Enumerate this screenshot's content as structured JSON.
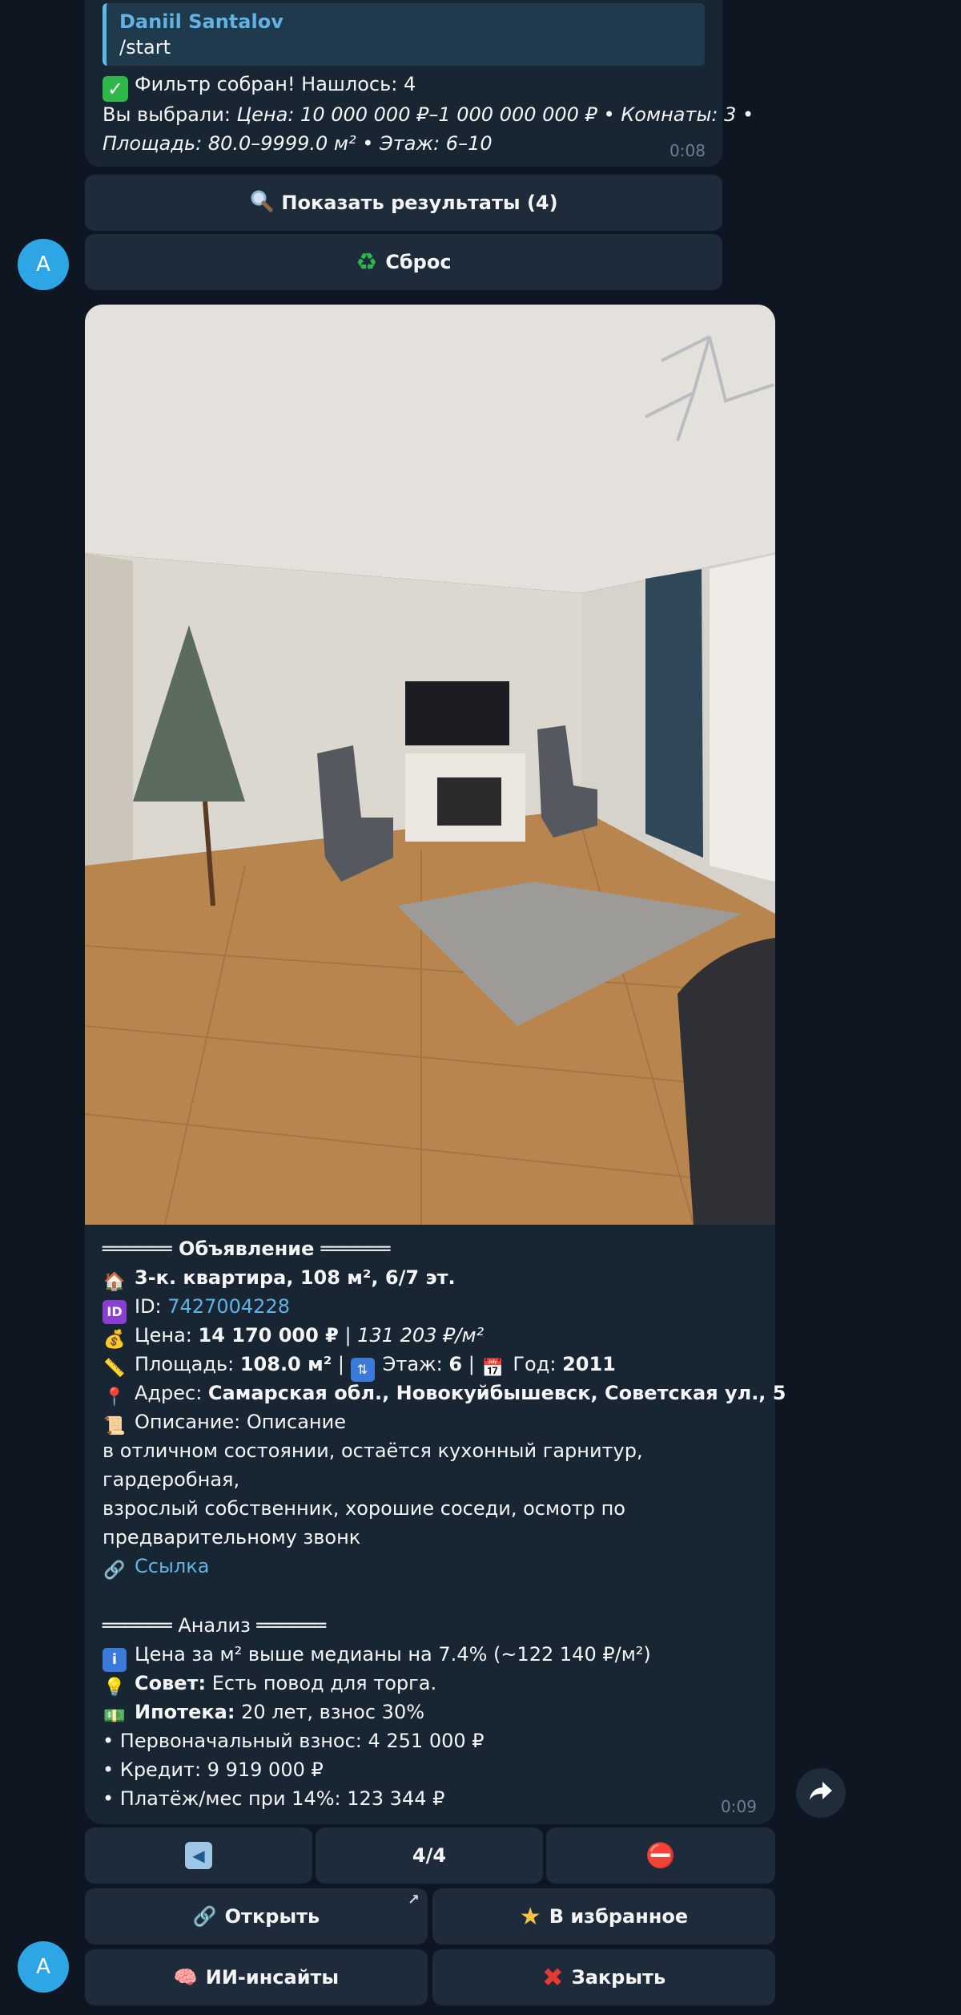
{
  "message1": {
    "quote_author": "Daniil Santalov",
    "quote_text": "/start",
    "filter_done": "Фильтр собран! Нашлось: 4",
    "selected_prefix": "Вы выбрали: ",
    "selected_line1": "Цена: 10 000 000 ₽–1 000 000 000 ₽ • Комнаты: 3 •",
    "selected_line2": "Площадь: 80.0–9999.0 м² • Этаж: 6–10",
    "time": "0:08"
  },
  "inline_keyboard_1": {
    "show_results": "Показать результаты (4)",
    "reset": "Сброс"
  },
  "avatar_letter": "A",
  "listing": {
    "header": "══════ Объявление ══════",
    "title": "3-к. квартира, 108 м², 6/7 эт.",
    "id_label": "ID: ",
    "id_value": "7427004228",
    "price_label": "Цена: ",
    "price_value": "14 170 000 ₽",
    "price_sep": " | ",
    "price_per_m2": "131 203 ₽/м²",
    "area_label": "Площадь: ",
    "area_value": "108.0 м²",
    "floor_label": "Этаж: ",
    "floor_value": "6",
    "year_label": "Год: ",
    "year_value": "2011",
    "address_label": "Адрес: ",
    "address_value": "Самарская обл., Новокуйбышевск, Советская ул., 5",
    "description_label": "Описание: Описание",
    "description_lines": [
      "в отличном состоянии, остаётся кухонный гарнитур,",
      "гардеробная,",
      "взрослый собственник, хорошие соседи, осмотр по",
      "предварительному звонк"
    ],
    "link_text": "Ссылка",
    "analysis_header": "══════ Анализ ══════",
    "analysis_price": "Цена за м² выше медианы на 7.4% (~122 140 ₽/м²)",
    "advice_label": "Совет:",
    "advice_text": " Есть повод для торга.",
    "mortgage_label": "Ипотека:",
    "mortgage_text": " 20 лет, взнос 30%",
    "down_payment": "• Первоначальный взнос: 4 251 000 ₽",
    "credit": "• Кредит: 9 919 000 ₽",
    "monthly": "• Платёж/мес при 14%: 123 344 ₽",
    "time": "0:09"
  },
  "inline_keyboard_2": {
    "prev": "◀",
    "page": "4/4",
    "stop": "⛔",
    "open": "Открыть",
    "favorite": "В избранное",
    "ai_insights": "ИИ-инсайты",
    "close": "Закрыть"
  },
  "colors": {
    "background": "#0e1621",
    "bubble": "#182533",
    "button": "#1d2b3a",
    "link": "#62b3e3",
    "avatar": "#2ea6e6"
  }
}
